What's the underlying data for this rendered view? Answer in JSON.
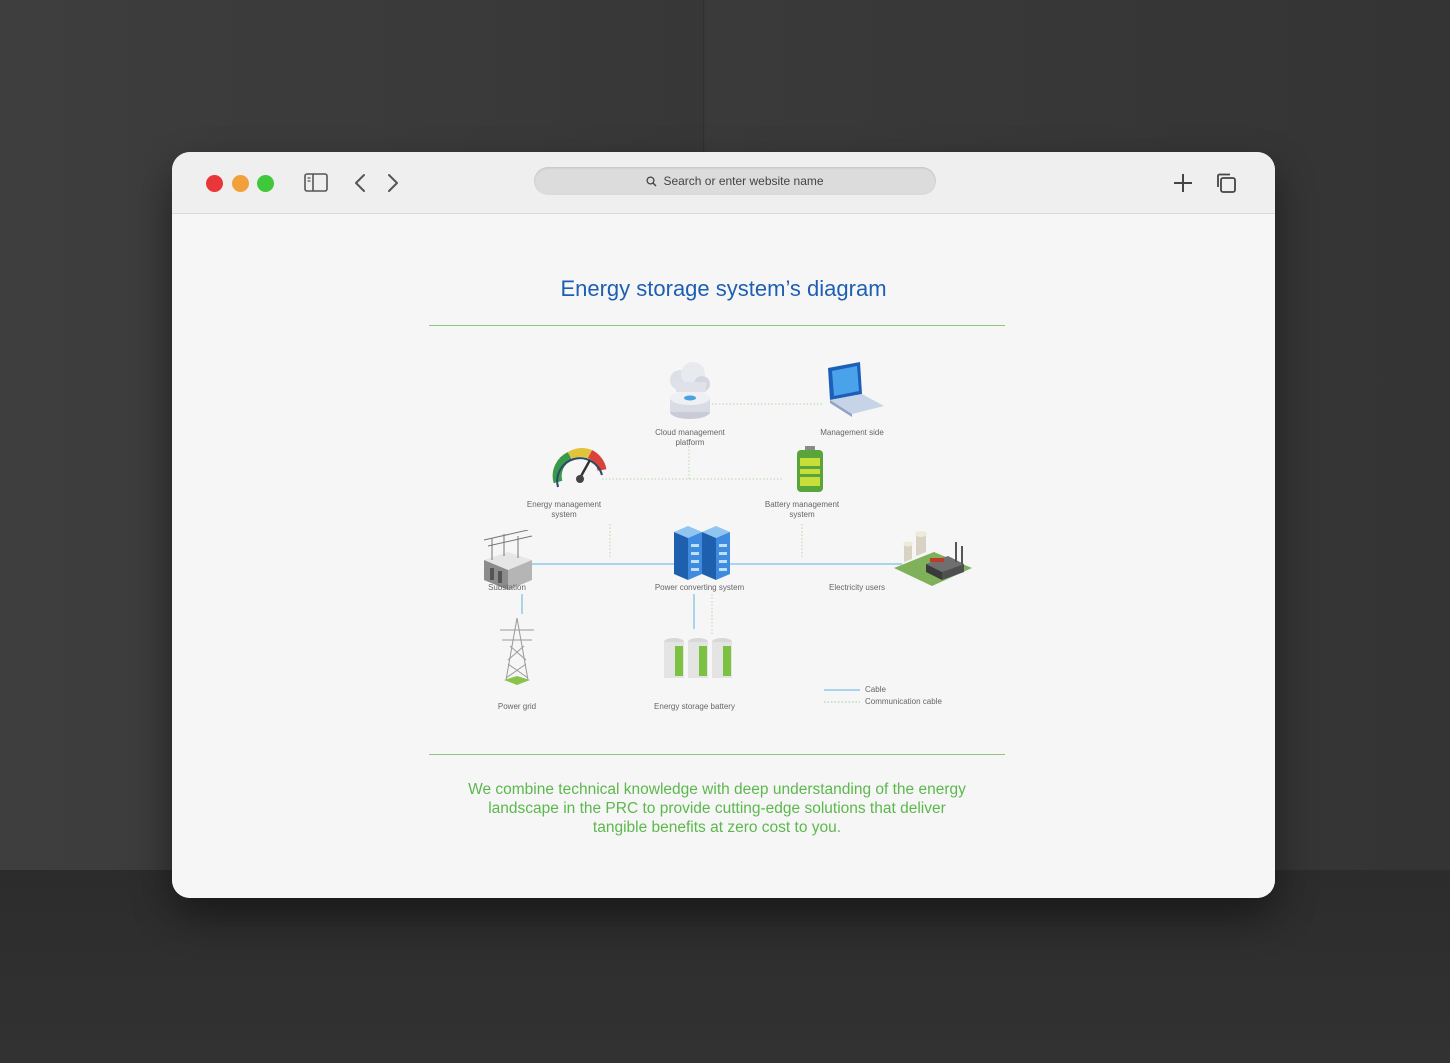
{
  "browser": {
    "address_placeholder": "Search or enter website name"
  },
  "page": {
    "title": "Energy storage system’s diagram",
    "tagline": "We combine technical knowledge with deep understanding of the energy landscape in the PRC to provide cutting-edge solutions that deliver tangible benefits at zero cost to you."
  },
  "diagram": {
    "nodes": {
      "cloud": "Cloud management platform",
      "management_side": "Management side",
      "ems": "Energy management system",
      "bms": "Battery management system",
      "substation": "Substation",
      "pcs": "Power converting system",
      "electricity_users": "Electricity users",
      "power_grid": "Power grid",
      "battery": "Energy storage battery"
    },
    "legend": {
      "cable": "Cable",
      "communication_cable": "Communication cable"
    }
  },
  "colors": {
    "title": "#1d5fb3",
    "accent_green": "#5cb84d",
    "cable": "#5ab4e0"
  }
}
